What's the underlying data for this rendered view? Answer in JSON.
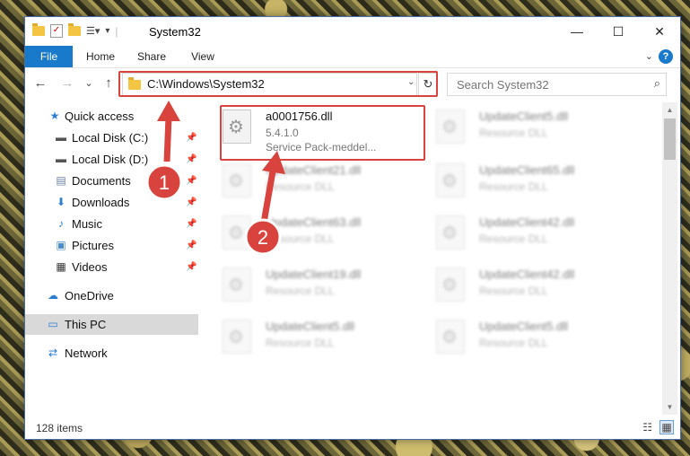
{
  "window": {
    "title": "System32",
    "minimize": "—",
    "maximize": "☐",
    "close": "✕"
  },
  "ribbon": {
    "tabs": [
      "File",
      "Home",
      "Share",
      "View"
    ],
    "help": "?",
    "expand": "⌄"
  },
  "navigation": {
    "back": "←",
    "forward": "→",
    "recent": "⌄",
    "up": "↑",
    "address": "C:\\Windows\\System32",
    "address_dropdown": "⌄",
    "refresh": "↻",
    "search_placeholder": "Search System32",
    "search_icon": "⌕"
  },
  "sidebar": {
    "items": [
      {
        "label": "Quick access",
        "icon": "★"
      },
      {
        "label": "Local Disk (C:)",
        "icon": "▬",
        "pin": "📌"
      },
      {
        "label": "Local Disk (D:)",
        "icon": "▬",
        "pin": "📌"
      },
      {
        "label": "Documents",
        "icon": "▤",
        "pin": "📌"
      },
      {
        "label": "Downloads",
        "icon": "⬇",
        "pin": "📌"
      },
      {
        "label": "Music",
        "icon": "♪",
        "pin": "📌"
      },
      {
        "label": "Pictures",
        "icon": "▣",
        "pin": "📌"
      },
      {
        "label": "Videos",
        "icon": "▦",
        "pin": "📌"
      },
      {
        "label": "OneDrive",
        "icon": "☁"
      },
      {
        "label": "This PC",
        "icon": "▭"
      },
      {
        "label": "Network",
        "icon": "⇄"
      }
    ]
  },
  "files": {
    "selected": {
      "name": "a0001756.dll",
      "version": "5.4.1.0",
      "description": "Service Pack-meddel..."
    },
    "others": [
      {
        "name": "UpdateClient5.dll",
        "type": "Resource DLL"
      },
      {
        "name": "UpdateClient21.dll",
        "type": "Resource DLL"
      },
      {
        "name": "UpdateClient65.dll",
        "type": "Resource DLL"
      },
      {
        "name": "UpdateClient63.dll",
        "type": "Resource DLL"
      },
      {
        "name": "UpdateClient42.dll",
        "type": "Resource DLL"
      },
      {
        "name": "UpdateClient19.dll",
        "type": "Resource DLL"
      },
      {
        "name": "UpdateClient42.dll",
        "type": "Resource DLL"
      },
      {
        "name": "UpdateClient5.dll",
        "type": "Resource DLL"
      },
      {
        "name": "UpdateClient5.dll",
        "type": "Resource DLL"
      }
    ]
  },
  "status": {
    "item_count": "128 items",
    "details_view_icon": "☷",
    "tiles_view_icon": "▦"
  },
  "annotations": {
    "step1": "1",
    "step2": "2",
    "highlight_color": "#d9433d"
  },
  "colors": {
    "accent": "#1979ca",
    "selection": "#d9d9d9"
  }
}
